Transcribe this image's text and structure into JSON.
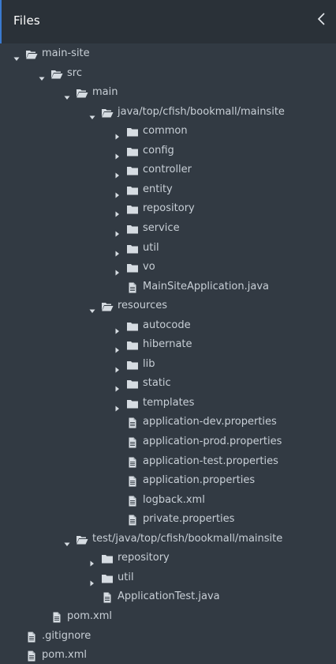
{
  "header": {
    "title": "Files"
  },
  "colors": {
    "background": "#323a43",
    "header": "#2a3138",
    "text": "#c8cfd6",
    "accent": "#3a7ad0"
  },
  "tree": [
    {
      "label": "main-site",
      "kind": "folder",
      "state": "open",
      "depth": 0
    },
    {
      "label": "src",
      "kind": "folder",
      "state": "open",
      "depth": 1
    },
    {
      "label": "main",
      "kind": "folder",
      "state": "open",
      "depth": 2
    },
    {
      "label": "java/top/cfish/bookmall/mainsite",
      "kind": "folder",
      "state": "open",
      "depth": 3
    },
    {
      "label": "common",
      "kind": "folder",
      "state": "closed",
      "depth": 4
    },
    {
      "label": "config",
      "kind": "folder",
      "state": "closed",
      "depth": 4
    },
    {
      "label": "controller",
      "kind": "folder",
      "state": "closed",
      "depth": 4
    },
    {
      "label": "entity",
      "kind": "folder",
      "state": "closed",
      "depth": 4
    },
    {
      "label": "repository",
      "kind": "folder",
      "state": "closed",
      "depth": 4
    },
    {
      "label": "service",
      "kind": "folder",
      "state": "closed",
      "depth": 4
    },
    {
      "label": "util",
      "kind": "folder",
      "state": "closed",
      "depth": 4
    },
    {
      "label": "vo",
      "kind": "folder",
      "state": "closed",
      "depth": 4
    },
    {
      "label": "MainSiteApplication.java",
      "kind": "file",
      "depth": 4
    },
    {
      "label": "resources",
      "kind": "folder",
      "state": "open",
      "depth": 3
    },
    {
      "label": "autocode",
      "kind": "folder",
      "state": "closed",
      "depth": 4
    },
    {
      "label": "hibernate",
      "kind": "folder",
      "state": "closed",
      "depth": 4
    },
    {
      "label": "lib",
      "kind": "folder",
      "state": "closed",
      "depth": 4
    },
    {
      "label": "static",
      "kind": "folder",
      "state": "closed",
      "depth": 4
    },
    {
      "label": "templates",
      "kind": "folder",
      "state": "closed",
      "depth": 4
    },
    {
      "label": "application-dev.properties",
      "kind": "file",
      "depth": 4
    },
    {
      "label": "application-prod.properties",
      "kind": "file",
      "depth": 4
    },
    {
      "label": "application-test.properties",
      "kind": "file",
      "depth": 4
    },
    {
      "label": "application.properties",
      "kind": "file",
      "depth": 4
    },
    {
      "label": "logback.xml",
      "kind": "file",
      "depth": 4
    },
    {
      "label": "private.properties",
      "kind": "file",
      "depth": 4
    },
    {
      "label": "test/java/top/cfish/bookmall/mainsite",
      "kind": "folder",
      "state": "open",
      "depth": 2
    },
    {
      "label": "repository",
      "kind": "folder",
      "state": "closed",
      "depth": 3
    },
    {
      "label": "util",
      "kind": "folder",
      "state": "closed",
      "depth": 3
    },
    {
      "label": "ApplicationTest.java",
      "kind": "file",
      "depth": 3
    },
    {
      "label": "pom.xml",
      "kind": "file",
      "depth": 1
    },
    {
      "label": ".gitignore",
      "kind": "file",
      "depth": 0
    },
    {
      "label": "pom.xml",
      "kind": "file",
      "depth": 0
    }
  ]
}
